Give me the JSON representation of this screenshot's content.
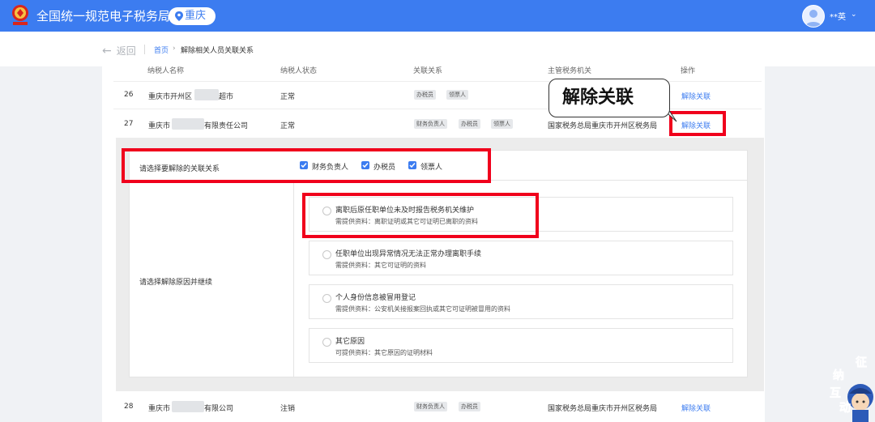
{
  "header": {
    "title": "全国统一规范电子税务局",
    "region": "重庆",
    "user": "**英",
    "emblem_text": "国家税务总局"
  },
  "breadcrumb": {
    "back": "返回",
    "home": "首页",
    "sep": "›",
    "current": "解除相关人员关联关系"
  },
  "table": {
    "headers": [
      "纳税人名称",
      "纳税人状态",
      "关联关系",
      "主管税务机关",
      "操作"
    ],
    "rows": [
      {
        "index": "26",
        "name_prefix": "重庆市开州区",
        "name_suffix": "超市",
        "status": "正常",
        "relations": [
          "办税员",
          "领票人"
        ],
        "authority": "",
        "action": "解除关联"
      },
      {
        "index": "27",
        "name_prefix": "重庆市",
        "name_suffix": "有限责任公司",
        "status": "正常",
        "relations": [
          "财务负责人",
          "办税员",
          "领票人"
        ],
        "authority": "国家税务总局重庆市开州区税务局",
        "action": "解除关联"
      },
      {
        "index": "28",
        "name_prefix": "重庆市",
        "name_suffix": "有限公司",
        "status": "注销",
        "relations": [
          "财务负责人",
          "办税员"
        ],
        "authority": "国家税务总局重庆市开州区税务局",
        "action": "解除关联"
      }
    ]
  },
  "callout": {
    "text": "解除关联"
  },
  "detail": {
    "relation_label": "请选择要解除的关联关系",
    "relation_options": [
      "财务负责人",
      "办税员",
      "领票人"
    ],
    "reason_label": "请选择解除原因并继续",
    "reasons": [
      {
        "title": "离职后原任职单位未及时报告税务机关维护",
        "desc": "需提供资料：离职证明或其它可证明已离职的资料"
      },
      {
        "title": "任职单位出现异常情况无法正常办理离职手续",
        "desc": "需提供资料：其它可证明的资料"
      },
      {
        "title": "个人身份信息被冒用登记",
        "desc": "需提供资料：公安机关接报案回执或其它可证明被冒用的资料"
      },
      {
        "title": "其它原因",
        "desc": "可提供资料：其它原因的证明材料"
      }
    ]
  },
  "mascot": {
    "chars": [
      "征",
      "纳",
      "互",
      "动"
    ]
  },
  "colors": {
    "brand": "#3c7cf0",
    "highlight": "#f0001c"
  }
}
